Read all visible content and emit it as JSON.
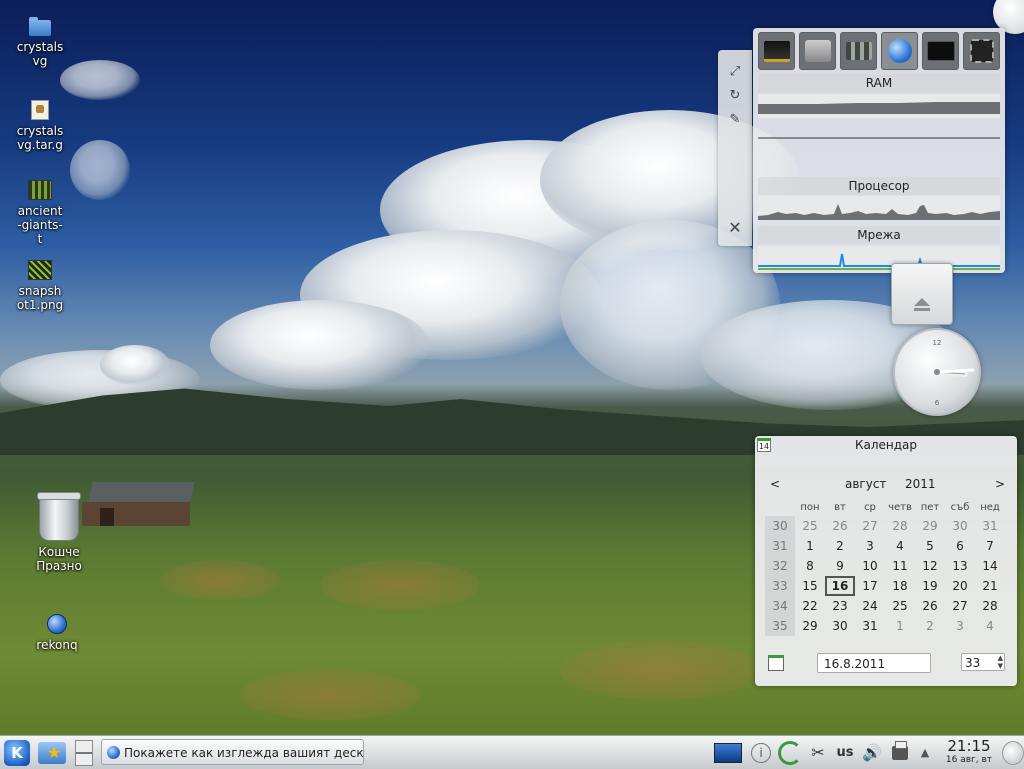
{
  "desktop_icons": [
    {
      "label": "crystalsvg",
      "icon": "folder-icon"
    },
    {
      "label": "crystalsvg.tar.g",
      "icon": "archive-icon"
    },
    {
      "label": "ancient-giants-t",
      "icon": "image-icon"
    },
    {
      "label": "snapshot1.png",
      "icon": "image-icon"
    },
    {
      "label": "Кошче Празно",
      "icon": "trash-icon"
    },
    {
      "label": "rekonq",
      "icon": "globe-icon"
    }
  ],
  "system_monitor": {
    "handle_buttons": [
      "resize-icon",
      "rotate-icon",
      "wrench-icon",
      "close-icon"
    ],
    "icons": [
      "ram-chip-icon",
      "hard-disk-icon",
      "hardware-icon",
      "network-globe-icon",
      "cpu-monitor-icon",
      "cpu-chip-icon"
    ],
    "sections": [
      "RAM",
      "Процесор",
      "Мрежа"
    ],
    "net_colors": {
      "in": "#1e8de0",
      "out": "#6ab04c"
    }
  },
  "calendar": {
    "title": "Календар",
    "badge_day": "14",
    "nav_prev": "<",
    "nav_next": ">",
    "month": "август",
    "year": "2011",
    "weekday_headers": [
      "пон",
      "вт",
      "ср",
      "четв",
      "пет",
      "съб",
      "нед"
    ],
    "weeks": [
      {
        "week": "30",
        "days": [
          "25",
          "26",
          "27",
          "28",
          "29",
          "30",
          "31"
        ]
      },
      {
        "week": "31",
        "days": [
          "1",
          "2",
          "3",
          "4",
          "5",
          "6",
          "7"
        ]
      },
      {
        "week": "32",
        "days": [
          "8",
          "9",
          "10",
          "11",
          "12",
          "13",
          "14"
        ]
      },
      {
        "week": "33",
        "days": [
          "15",
          "16",
          "17",
          "18",
          "19",
          "20",
          "21"
        ]
      },
      {
        "week": "34",
        "days": [
          "22",
          "23",
          "24",
          "25",
          "26",
          "27",
          "28"
        ]
      },
      {
        "week": "35",
        "days": [
          "29",
          "30",
          "31",
          "1",
          "2",
          "3",
          "4"
        ]
      }
    ],
    "today": "16",
    "date_field": "16.8.2011",
    "week_field": "33"
  },
  "taskbar": {
    "task_label": "Покажете как изглежда вашият десктоп",
    "keyboard_layout": "us",
    "time": "21:15",
    "date": "16 авг, вт"
  },
  "colors": {
    "accent": "#1f63c8",
    "today_border": "#555555"
  }
}
